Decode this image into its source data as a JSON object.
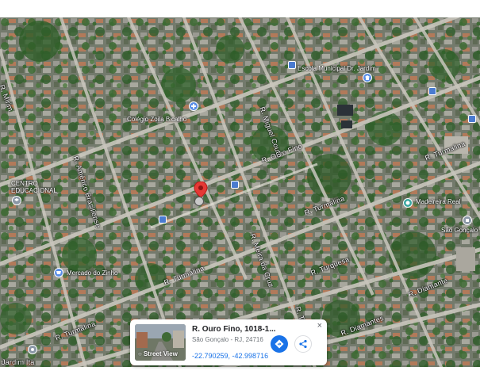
{
  "map": {
    "streets": {
      "ouro_fino_upper": "R. Ouro Fino",
      "ouro_fino_lower": "R. Ouro Fino",
      "turmalina_right": "R. Turmalina",
      "turmalina_mid": "R. Turmalina",
      "turmalina_lower": "R. Turmalina",
      "turmalina_left": "R. Turmalina",
      "turquesa": "R. Turquesa",
      "diamantes": "R. Diamantes",
      "diamante_right": "R. Diamante",
      "miguel_couto": "R. Miguel Couto",
      "americo_left": "R. Américo Brasiliense",
      "meira_cruz": "R. Meira da Cruz",
      "topazio": "R. Topázio",
      "mirim": "R. Mirim",
      "corner_bottom_left": "Jardim Ita"
    },
    "places": {
      "school": "Escola Municipal Dr. Jardim",
      "market": "Mercado do Zinho",
      "pharmacy": "Colégio Zoila Bicalho",
      "centro": "CENTRO EDUCACIONAL",
      "madeireira": "Madeireira Real",
      "right_place": "São Gonçalo"
    },
    "colors": {
      "pin": "#e53935",
      "poi_blue": "#5a8ee6",
      "poi_teal": "#3aa6a0",
      "link": "#1a73e8"
    }
  },
  "card": {
    "title": "R. Ouro Fino, 1018-1...",
    "subtitle": "São Gonçalo - RJ, 24716",
    "coords": "-22.790259, -42.998716",
    "thumb_label": "Street View",
    "close_label": "×",
    "icons": {
      "directions": "directions-icon",
      "share": "share-icon",
      "streetview": "street-view-icon"
    }
  }
}
